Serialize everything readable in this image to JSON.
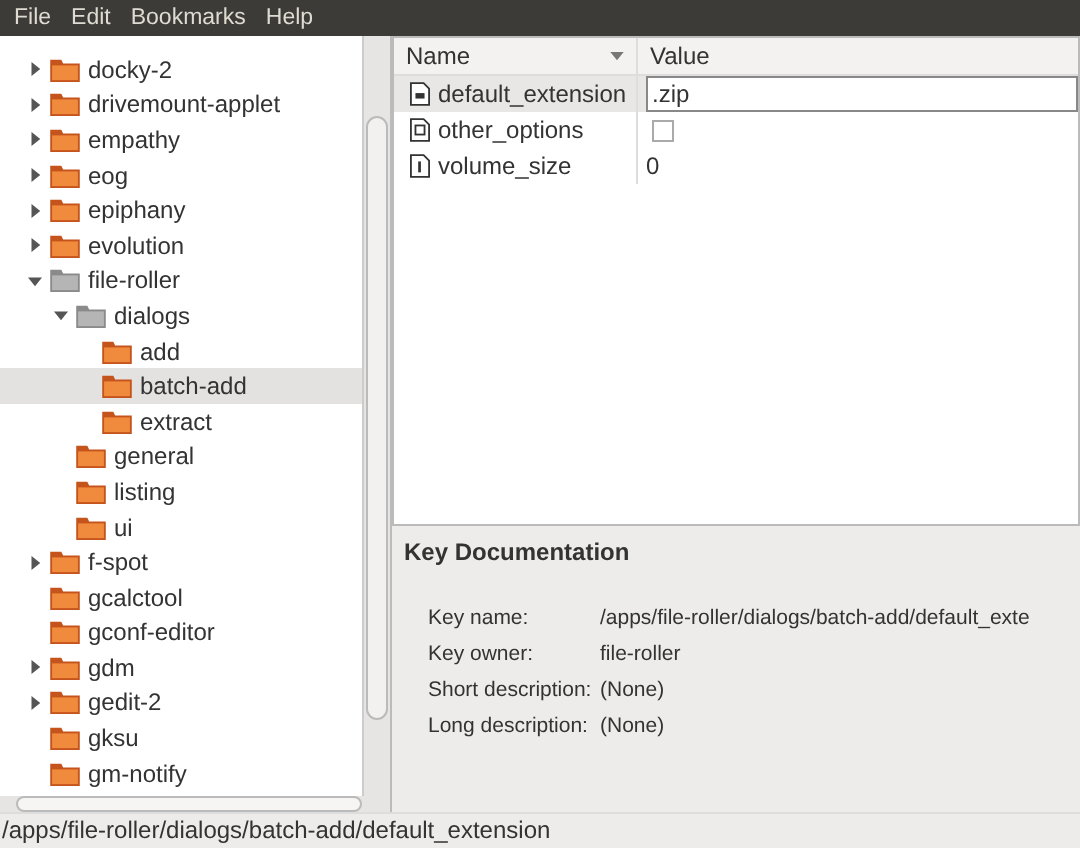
{
  "menu": [
    "File",
    "Edit",
    "Bookmarks",
    "Help"
  ],
  "tree": [
    {
      "label": "docky-2",
      "expandable": true,
      "expanded": false,
      "selected": false
    },
    {
      "label": "drivemount-applet",
      "expandable": true,
      "expanded": false,
      "selected": false
    },
    {
      "label": "empathy",
      "expandable": true,
      "expanded": false,
      "selected": false
    },
    {
      "label": "eog",
      "expandable": true,
      "expanded": false,
      "selected": false
    },
    {
      "label": "epiphany",
      "expandable": true,
      "expanded": false,
      "selected": false
    },
    {
      "label": "evolution",
      "expandable": true,
      "expanded": false,
      "selected": false
    },
    {
      "label": "file-roller",
      "expandable": true,
      "expanded": true,
      "selected": false,
      "children": [
        {
          "label": "dialogs",
          "expandable": true,
          "expanded": true,
          "selected": false,
          "children": [
            {
              "label": "add",
              "expandable": false,
              "expanded": false,
              "selected": false
            },
            {
              "label": "batch-add",
              "expandable": false,
              "expanded": false,
              "selected": true
            },
            {
              "label": "extract",
              "expandable": false,
              "expanded": false,
              "selected": false
            }
          ]
        },
        {
          "label": "general",
          "expandable": false,
          "expanded": false,
          "selected": false
        },
        {
          "label": "listing",
          "expandable": false,
          "expanded": false,
          "selected": false
        },
        {
          "label": "ui",
          "expandable": false,
          "expanded": false,
          "selected": false
        }
      ]
    },
    {
      "label": "f-spot",
      "expandable": true,
      "expanded": false,
      "selected": false
    },
    {
      "label": "gcalctool",
      "expandable": false,
      "expanded": false,
      "selected": false
    },
    {
      "label": "gconf-editor",
      "expandable": false,
      "expanded": false,
      "selected": false
    },
    {
      "label": "gdm",
      "expandable": true,
      "expanded": false,
      "selected": false
    },
    {
      "label": "gedit-2",
      "expandable": true,
      "expanded": false,
      "selected": false
    },
    {
      "label": "gksu",
      "expandable": false,
      "expanded": false,
      "selected": false
    },
    {
      "label": "gm-notify",
      "expandable": false,
      "expanded": false,
      "selected": false
    }
  ],
  "table": {
    "columns": [
      "Name",
      "Value"
    ],
    "rows": [
      {
        "name": "default_extension",
        "kind": "string",
        "value": ".zip",
        "selected": true
      },
      {
        "name": "other_options",
        "kind": "bool",
        "checked": false,
        "selected": false
      },
      {
        "name": "volume_size",
        "kind": "int",
        "value": "0",
        "selected": false
      }
    ]
  },
  "doc": {
    "title": "Key Documentation",
    "rows": [
      {
        "label": "Key name:",
        "value": "/apps/file-roller/dialogs/batch-add/default_exte"
      },
      {
        "label": "Key owner:",
        "value": "file-roller"
      },
      {
        "label": "Short description:",
        "value": "(None)"
      },
      {
        "label": "Long description:",
        "value": "(None)"
      }
    ]
  },
  "status_bar": "/apps/file-roller/dialogs/batch-add/default_extension"
}
